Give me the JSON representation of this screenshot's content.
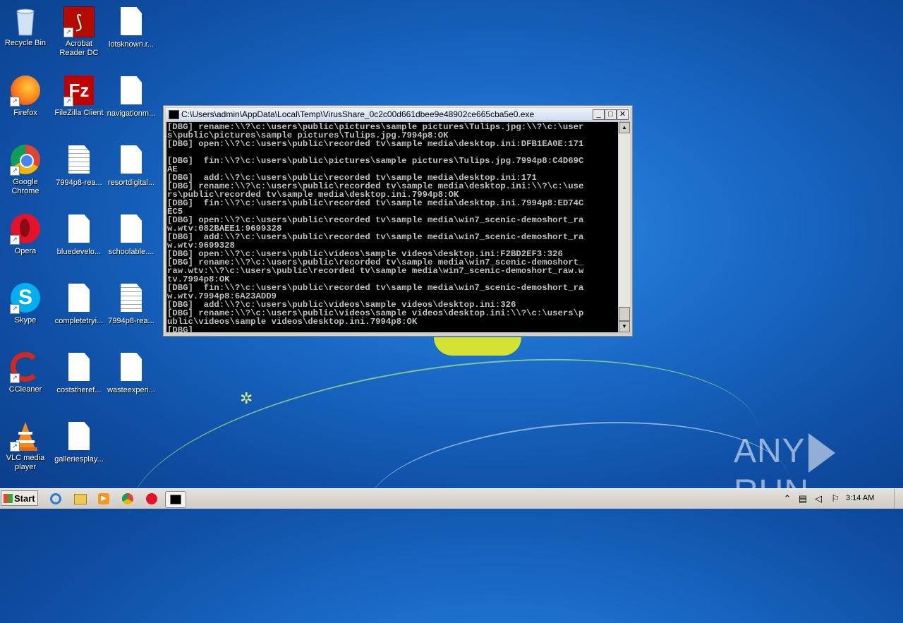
{
  "desktop": {
    "icons": [
      {
        "label": "Recycle Bin",
        "icon": "recycle-bin-icon"
      },
      {
        "label": "Acrobat Reader DC",
        "icon": "acrobat-icon"
      },
      {
        "label": "lotsknown.r...",
        "icon": "document-icon"
      },
      {
        "label": "Firefox",
        "icon": "firefox-icon"
      },
      {
        "label": "FileZilla Client",
        "icon": "filezilla-icon"
      },
      {
        "label": "navigationm...",
        "icon": "document-icon"
      },
      {
        "label": "Google Chrome",
        "icon": "chrome-icon"
      },
      {
        "label": "7994p8-rea...",
        "icon": "text-document-icon"
      },
      {
        "label": "resortdigital...",
        "icon": "document-icon"
      },
      {
        "label": "Opera",
        "icon": "opera-icon"
      },
      {
        "label": "bluedevelo...",
        "icon": "document-icon"
      },
      {
        "label": "schoolable....",
        "icon": "document-icon"
      },
      {
        "label": "Skype",
        "icon": "skype-icon"
      },
      {
        "label": "completetryi...",
        "icon": "document-icon"
      },
      {
        "label": "7994p8-rea...",
        "icon": "text-document-icon"
      },
      {
        "label": "CCleaner",
        "icon": "ccleaner-icon"
      },
      {
        "label": "coststheref...",
        "icon": "document-icon"
      },
      {
        "label": "wasteexperi...",
        "icon": "document-icon"
      },
      {
        "label": "VLC media player",
        "icon": "vlc-icon"
      },
      {
        "label": "galleriesplay...",
        "icon": "document-icon"
      }
    ]
  },
  "console": {
    "title": "C:\\Users\\admin\\AppData\\Local\\Temp\\VirusShare_0c2c00d661dbee9e48902ce665cba5e0.exe",
    "buttons": {
      "minimize": "_",
      "maximize": "□",
      "close": "✕"
    },
    "text": "[DBG] rename:\\\\?\\c:\\users\\public\\pictures\\sample pictures\\Tulips.jpg:\\\\?\\c:\\user\ns\\public\\pictures\\sample pictures\\Tulips.jpg.7994p8:OK\n[DBG] open:\\\\?\\c:\\users\\public\\recorded tv\\sample media\\desktop.ini:DFB1EA0E:171\n\n[DBG]  fin:\\\\?\\c:\\users\\public\\pictures\\sample pictures\\Tulips.jpg.7994p8:C4D69C\nAE\n[DBG]  add:\\\\?\\c:\\users\\public\\recorded tv\\sample media\\desktop.ini:171\n[DBG] rename:\\\\?\\c:\\users\\public\\recorded tv\\sample media\\desktop.ini:\\\\?\\c:\\use\nrs\\public\\recorded tv\\sample media\\desktop.ini.7994p8:OK\n[DBG]  fin:\\\\?\\c:\\users\\public\\recorded tv\\sample media\\desktop.ini.7994p8:ED74C\nEC5\n[DBG] open:\\\\?\\c:\\users\\public\\recorded tv\\sample media\\win7_scenic-demoshort_ra\nw.wtv:082BAEE1:9699328\n[DBG]  add:\\\\?\\c:\\users\\public\\recorded tv\\sample media\\win7_scenic-demoshort_ra\nw.wtv:9699328\n[DBG] open:\\\\?\\c:\\users\\public\\videos\\sample videos\\desktop.ini:F2BD2EF3:326\n[DBG] rename:\\\\?\\c:\\users\\public\\recorded tv\\sample media\\win7_scenic-demoshort_\nraw.wtv:\\\\?\\c:\\users\\public\\recorded tv\\sample media\\win7_scenic-demoshort_raw.w\ntv.7994p8:OK\n[DBG]  fin:\\\\?\\c:\\users\\public\\recorded tv\\sample media\\win7_scenic-demoshort_ra\nw.wtv.7994p8:6A23ADD9\n[DBG]  add:\\\\?\\c:\\users\\public\\videos\\sample videos\\desktop.ini:326\n[DBG] rename:\\\\?\\c:\\users\\public\\videos\\sample videos\\desktop.ini:\\\\?\\c:\\users\\p\nublic\\videos\\sample videos\\desktop.ini.7994p8:OK\n[DBG]"
  },
  "watermark": {
    "left": "ANY",
    "right": "RUN"
  },
  "taskbar": {
    "start_label": "Start",
    "items": [
      "ie-icon",
      "explorer-icon",
      "media-player-icon",
      "chrome-icon",
      "opera-icon",
      "console-icon"
    ],
    "tray_icons": [
      "chevron-up-icon",
      "network-icon",
      "volume-icon",
      "flag-icon"
    ],
    "clock": "3:14 AM"
  }
}
